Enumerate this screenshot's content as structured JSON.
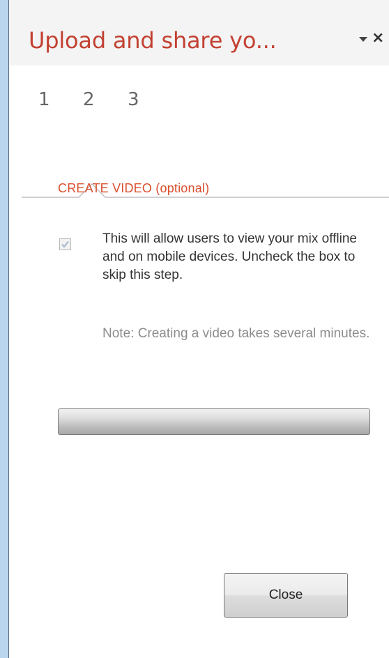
{
  "pane": {
    "title": "Upload and share yo...",
    "menu_icon": "triangle-down-icon",
    "close_icon": "close-icon",
    "close_glyph": "×"
  },
  "steps": {
    "items": [
      "1",
      "2",
      "3"
    ],
    "active_index": 1
  },
  "section": {
    "heading": "CREATE VIDEO (optional)",
    "checkbox_checked": true,
    "description": "This will allow users to view your mix offline and on mobile devices. Uncheck the box to skip this step.",
    "note": "Note: Creating a video takes several minutes."
  },
  "progress": {
    "value_percent": 100
  },
  "footer": {
    "close_label": "Close"
  },
  "colors": {
    "title": "#c24132",
    "heading": "#d9502e",
    "frame_background": "#bad6ee",
    "note_text": "#8c8c8c"
  }
}
